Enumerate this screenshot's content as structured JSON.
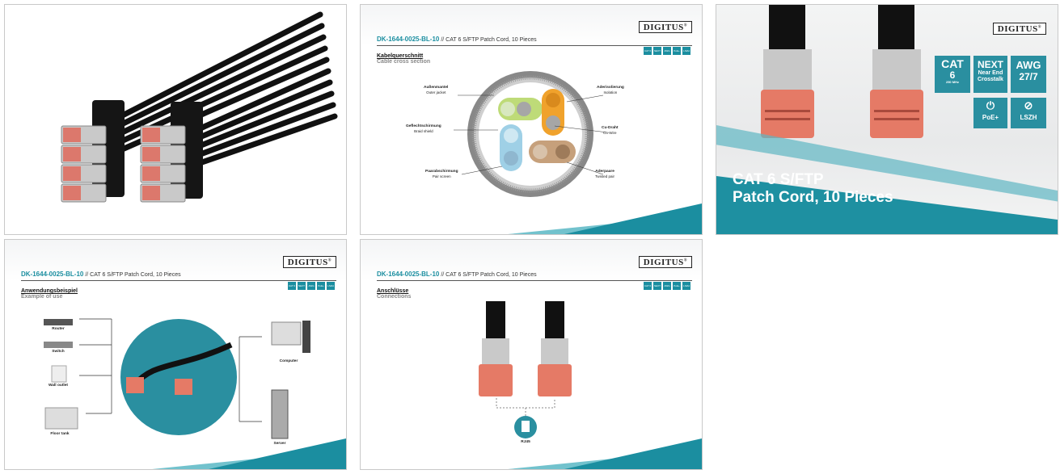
{
  "logo": "DIGITUS",
  "header": {
    "sku": "DK-1644-0025-BL-10",
    "separator": " // ",
    "product": "CAT 6 S/FTP Patch Cord, 10 Pieces"
  },
  "spec_badges": [
    "CAT 6",
    "NEXT",
    "AWG 27/7",
    "PoE+",
    "LSZH"
  ],
  "slide_cross_section": {
    "title_de": "Kabelquerschnitt",
    "title_en": "Cable cross section",
    "labels": [
      {
        "de": "Außenmantel",
        "en": "Outer jacket"
      },
      {
        "de": "Aderisolierung",
        "en": "Isolation"
      },
      {
        "de": "Geflechtschirmung",
        "en": "Braid shield"
      },
      {
        "de": "Cu-Draht",
        "en": "Cu-Wire"
      },
      {
        "de": "Paarabschirmung",
        "en": "Pair screen"
      },
      {
        "de": "Aderpaare",
        "en": "Twisted pair"
      }
    ]
  },
  "slide_hero": {
    "title_line1": "CAT 6 S/FTP",
    "title_line2": "Patch Cord, 10 Pieces",
    "badges": [
      {
        "main": "CAT",
        "sub": "6",
        "note": "250 MHz"
      },
      {
        "main": "NEXT",
        "sub": "Near End",
        "note": "Crosstalk"
      },
      {
        "main": "AWG",
        "sub": "27/7",
        "note": ""
      },
      {
        "main": "",
        "sub": "PoE+",
        "note": ""
      },
      {
        "main": "",
        "sub": "LSZH",
        "note": ""
      }
    ]
  },
  "slide_use": {
    "title_de": "Anwendungsbeispiel",
    "title_en": "Example of use",
    "devices": [
      "Router",
      "Switch",
      "Wall outlet",
      "Floor tank",
      "Computer",
      "Server"
    ]
  },
  "slide_connections": {
    "title_de": "Anschlüsse",
    "title_en": "Connections",
    "connector": "RJ45"
  },
  "colors": {
    "accent": "#1b8ea0",
    "connector": "#e06a5c",
    "cable": "#111111"
  }
}
